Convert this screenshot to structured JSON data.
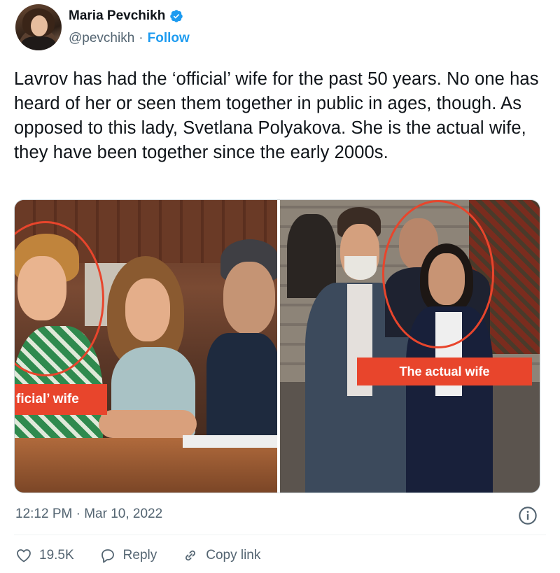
{
  "author": {
    "name": "Maria Pevchikh",
    "handle": "@pevchikh",
    "separator": "·",
    "follow_label": "Follow"
  },
  "tweet": {
    "text": "Lavrov has had the ‘official’ wife for the past 50 years. No one has heard of her or seen them together in public in ages, though. As opposed to this lady, Svetlana Polyakova. She is the actual wife, they have been together since the early 2000s."
  },
  "media": {
    "left_label": "ficial’ wife",
    "right_label": "The actual wife",
    "accent_color": "#e8452c"
  },
  "footer": {
    "timestamp": "12:12 PM · Mar 10, 2022",
    "likes_count": "19.5K",
    "reply_label": "Reply",
    "copy_link_label": "Copy link"
  },
  "icons": {
    "verified": "verified-badge-icon",
    "twitter": "twitter-bird-icon",
    "info": "info-icon",
    "like": "heart-icon",
    "reply": "reply-bubble-icon",
    "copy_link": "link-icon"
  },
  "colors": {
    "brand_blue": "#1d9bf0",
    "text_secondary": "#536471",
    "text_primary": "#0f1419"
  }
}
